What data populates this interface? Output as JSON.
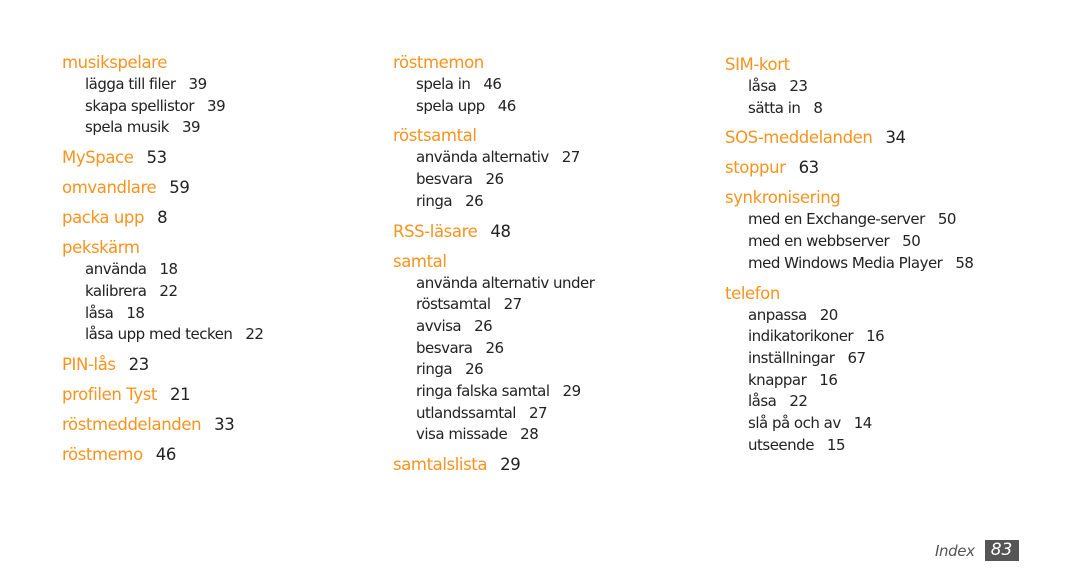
{
  "accent_color": "#f7931e",
  "columns": [
    [
      {
        "term": "musikspelare",
        "page": "",
        "subs": [
          {
            "t": "lägga till filer",
            "p": "39"
          },
          {
            "t": "skapa spellistor",
            "p": "39"
          },
          {
            "t": "spela musik",
            "p": "39"
          }
        ]
      },
      {
        "term": "MySpace",
        "page": "53",
        "subs": []
      },
      {
        "term": "omvandlare",
        "page": "59",
        "subs": []
      },
      {
        "term": "packa upp",
        "page": "8",
        "subs": []
      },
      {
        "term": "pekskärm",
        "page": "",
        "subs": [
          {
            "t": "använda",
            "p": "18"
          },
          {
            "t": "kalibrera",
            "p": "22"
          },
          {
            "t": "låsa",
            "p": "18"
          },
          {
            "t": "låsa upp med tecken",
            "p": "22"
          }
        ]
      },
      {
        "term": "PIN-lås",
        "page": "23",
        "subs": []
      },
      {
        "term": "profilen Tyst",
        "page": "21",
        "subs": []
      },
      {
        "term": "röstmeddelanden",
        "page": "33",
        "subs": []
      },
      {
        "term": "röstmemo",
        "page": "46",
        "subs": []
      }
    ],
    [
      {
        "term": "röstmemon",
        "page": "",
        "subs": [
          {
            "t": "spela in",
            "p": "46"
          },
          {
            "t": "spela upp",
            "p": "46"
          }
        ]
      },
      {
        "term": "röstsamtal",
        "page": "",
        "subs": [
          {
            "t": "använda alternativ",
            "p": "27"
          },
          {
            "t": "besvara",
            "p": "26"
          },
          {
            "t": "ringa",
            "p": "26"
          }
        ]
      },
      {
        "term": "RSS-läsare",
        "page": "48",
        "subs": []
      },
      {
        "term": "samtal",
        "page": "",
        "subs": [
          {
            "t": "använda alternativ under",
            "p": ""
          },
          {
            "t": "röstsamtal",
            "p": "27"
          },
          {
            "t": "avvisa",
            "p": "26"
          },
          {
            "t": "besvara",
            "p": "26"
          },
          {
            "t": "ringa",
            "p": "26"
          },
          {
            "t": "ringa falska samtal",
            "p": "29"
          },
          {
            "t": "utlandssamtal",
            "p": "27"
          },
          {
            "t": "visa missade",
            "p": "28"
          }
        ]
      },
      {
        "term": "samtalslista",
        "page": "29",
        "subs": []
      }
    ],
    [
      {
        "term": "SIM-kort",
        "page": "",
        "subs": [
          {
            "t": "låsa",
            "p": "23"
          },
          {
            "t": "sätta in",
            "p": "8"
          }
        ]
      },
      {
        "term": "SOS-meddelanden",
        "page": "34",
        "subs": []
      },
      {
        "term": "stoppur",
        "page": "63",
        "subs": []
      },
      {
        "term": "synkronisering",
        "page": "",
        "subs": [
          {
            "t": "med en Exchange-server",
            "p": "50"
          },
          {
            "t": "med en webbserver",
            "p": "50"
          },
          {
            "t": "med Windows Media Player",
            "p": "58"
          }
        ]
      },
      {
        "term": "telefon",
        "page": "",
        "subs": [
          {
            "t": "anpassa",
            "p": "20"
          },
          {
            "t": "indikatorikoner",
            "p": "16"
          },
          {
            "t": "inställningar",
            "p": "67"
          },
          {
            "t": "knappar",
            "p": "16"
          },
          {
            "t": "låsa",
            "p": "22"
          },
          {
            "t": "slå på och av",
            "p": "14"
          },
          {
            "t": "utseende",
            "p": "15"
          }
        ]
      }
    ]
  ],
  "footer": {
    "label": "Index",
    "page_number": "83"
  }
}
